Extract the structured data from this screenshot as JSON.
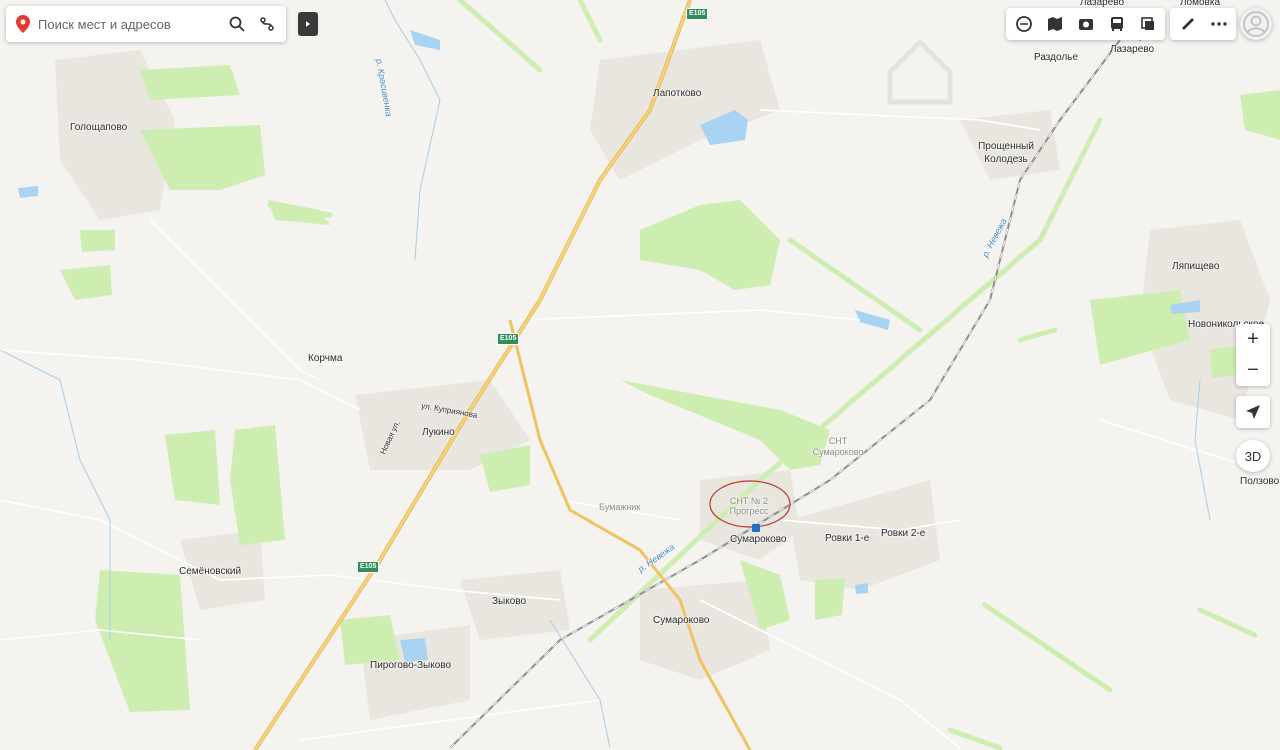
{
  "search": {
    "placeholder": "Поиск мест и адресов"
  },
  "map_labels": {
    "goloshchapovo": "Голощапово",
    "lapotkovo": "Лапотково",
    "razdolye": "Раздолье",
    "stantsiya_lazarevo": "Станция\nЛазарево",
    "lazarevo": "Лазарево",
    "lomovka": "Ломовка",
    "proshchenny_kolodez": "Прощенный\nКолодезь",
    "lyapishchevo": "Ляпищево",
    "novonikolskoe": "Новоникольское",
    "korchma": "Корчма",
    "lukino": "Лукино",
    "ul_kupriyanova": "ул. Куприянова",
    "novaya_ul": "Новая ул.",
    "snt_sumarokovo": "СНТ\nСумароково",
    "snt_progress": "СНТ № 2\nПрогресс",
    "bumazhnik": "Бумажник",
    "sumarokovo_station": "Сумароково",
    "rovki_1": "Ровки 1-е",
    "rovki_2": "Ровки 2-е",
    "polzovo": "Ползово",
    "semenovsky": "Семёновский",
    "zykovo": "Зыково",
    "sumarokovo": "Сумароково",
    "pirogovo_zykovo": "Пирогово-Зыково",
    "river_krasivenka": "р. Красивенка",
    "river_nevezha_1": "р. Невежа",
    "river_nevezha_2": "р. Невежа"
  },
  "road_shields": {
    "e105_top": "E105",
    "e105_mid": "E105",
    "e105_low": "E105"
  },
  "controls": {
    "zoom_in": "+",
    "zoom_out": "−",
    "btn_3d": "3D"
  },
  "toolbar_icons": [
    "layers-icon",
    "map-type-icon",
    "panorama-icon",
    "transport-icon",
    "traffic-icon",
    "ruler-icon",
    "more-icon"
  ],
  "colors": {
    "forest": "#cdeeb0",
    "forest_dark": "#b8e49a",
    "water": "#a9d3f2",
    "road_major": "#f4c96a",
    "railway": "#9a9a9a",
    "settlement": "#e9e6e0",
    "marker": "#e53935"
  }
}
